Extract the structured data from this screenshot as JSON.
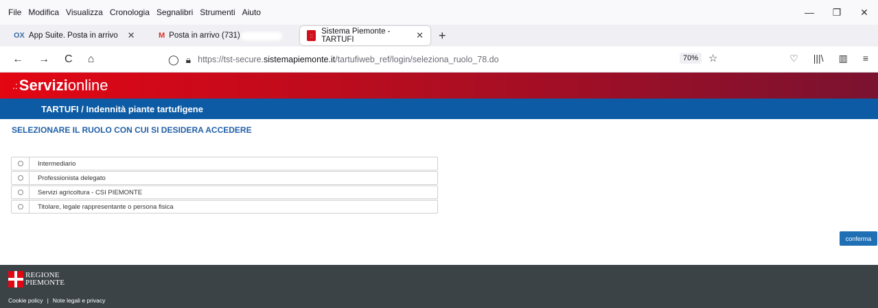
{
  "browser": {
    "menu": [
      "File",
      "Modifica",
      "Visualizza",
      "Cronologia",
      "Segnalibri",
      "Strumenti",
      "Aiuto"
    ],
    "window_controls": {
      "minimize": "—",
      "restore": "❐",
      "close": "✕"
    },
    "tabs": [
      {
        "favicon": "ox-icon",
        "fav_text": "OX",
        "title": "App Suite. Posta in arrivo"
      },
      {
        "favicon": "gmail-icon",
        "fav_text": "M",
        "title": "Posta in arrivo (731)"
      },
      {
        "favicon": "sistema-piemonte-icon",
        "fav_text": "::",
        "title": "Sistema Piemonte - TARTUFI"
      }
    ],
    "tab_close": "✕",
    "new_tab": "+",
    "nav": {
      "back": "←",
      "forward": "→",
      "reload": "C",
      "home": "⌂"
    },
    "url": {
      "prefix": "https://tst-secure.",
      "domain": "sistemapiemonte.it",
      "path": "/tartufiweb_ref/login/seleziona_ruolo_78.do"
    },
    "zoom": "70%",
    "bookmark_star": "☆",
    "toolbar_icons": {
      "pocket": "♡",
      "library": "|||\\",
      "sidebar": "▥",
      "menu": "≡"
    }
  },
  "page": {
    "brand": {
      "dots": ".:",
      "bold": "Servizi",
      "light": "online"
    },
    "app_title": "TARTUFI / Indennità piante tartufigene",
    "heading": "SELEZIONARE IL RUOLO CON CUI SI DESIDERA ACCEDERE",
    "roles": [
      "Intermediario",
      "Professionista delegato",
      "Servizi agricoltura - CSI PIEMONTE",
      "Titolare, legale rappresentante o persona fisica"
    ],
    "confirm_label": "conferma",
    "footer": {
      "logo_line1": "REGIONE",
      "logo_line2": "PIEMONTE",
      "cookie": "Cookie policy",
      "separator": "|",
      "legal": "Note legali e privacy"
    }
  },
  "colors": {
    "brand_red": "#e30613",
    "title_blue": "#0d5ba5",
    "heading_blue": "#1f5fa6",
    "button_blue": "#1f6fb5",
    "footer_gray": "#3c4347"
  }
}
